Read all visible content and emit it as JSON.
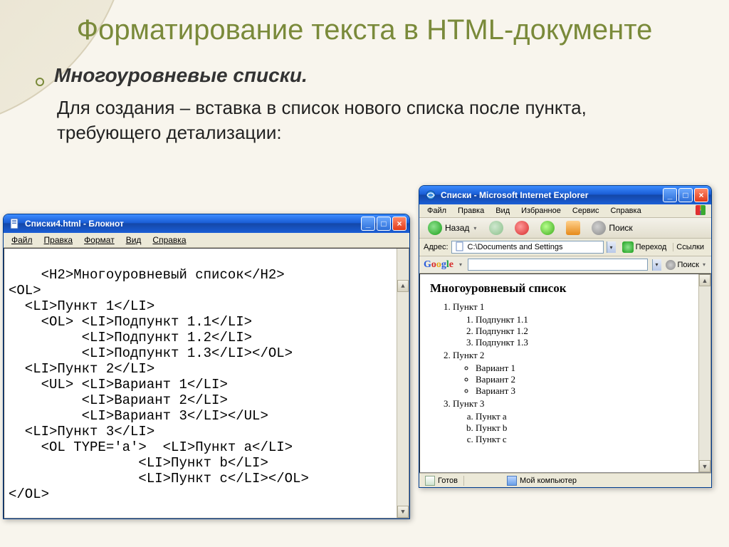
{
  "slide": {
    "title": "Форматирование текста в HTML-документе",
    "bullet": "Многоуровневые списки.",
    "body": "Для создания – вставка в список нового списка после пункта, требующего детализации:"
  },
  "common": {
    "min": "_",
    "max": "□",
    "close": "×",
    "scroll_up": "▲",
    "scroll_down": "▼",
    "caret": "▾"
  },
  "notepad": {
    "title": "Списки4.html - Блокнот",
    "menu": {
      "file": "Файл",
      "edit": "Правка",
      "format": "Формат",
      "view": "Вид",
      "help": "Справка"
    },
    "code": "<H2>Многоуровневый список</H2>\n<OL>\n  <LI>Пункт 1</LI>\n    <OL> <LI>Подпункт 1.1</LI>\n         <LI>Подпункт 1.2</LI>\n         <LI>Подпункт 1.3</LI></OL>\n  <LI>Пункт 2</LI>\n    <UL> <LI>Вариант 1</LI>\n         <LI>Вариант 2</LI>\n         <LI>Вариант 3</LI></UL>\n  <LI>Пункт 3</LI>\n    <OL TYPE='a'>  <LI>Пункт a</LI>\n                <LI>Пункт b</LI>\n                <LI>Пункт c</LI></OL>\n</OL>"
  },
  "ie": {
    "title": "Списки - Microsoft Internet Explorer",
    "menu": {
      "file": "Файл",
      "edit": "Правка",
      "view": "Вид",
      "fav": "Избранное",
      "tools": "Сервис",
      "help": "Справка"
    },
    "toolbar": {
      "back": "Назад",
      "search": "Поиск"
    },
    "addr": {
      "label": "Адрес:",
      "value": "C:\\Documents and Settings",
      "go": "Переход",
      "links": "Ссылки"
    },
    "google": {
      "logo": "Google",
      "search": "Поиск"
    },
    "content": {
      "heading": "Многоуровневый список",
      "p1": "Пункт 1",
      "p1_1": "Подпункт 1.1",
      "p1_2": "Подпункт 1.2",
      "p1_3": "Подпункт 1.3",
      "p2": "Пункт 2",
      "v1": "Вариант 1",
      "v2": "Вариант 2",
      "v3": "Вариант 3",
      "p3": "Пункт 3",
      "pa": "Пункт a",
      "pb": "Пункт b",
      "pc": "Пункт c"
    },
    "status": {
      "ready": "Готов",
      "mycomp": "Мой компьютер"
    }
  }
}
